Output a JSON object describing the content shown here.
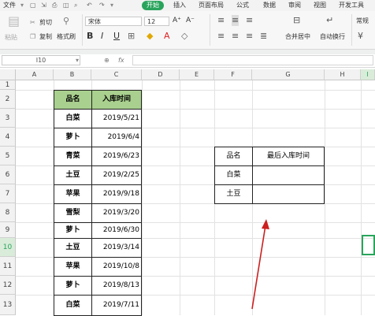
{
  "menubar": {
    "file": "文件",
    "tabs": [
      "开始",
      "插入",
      "页面布局",
      "公式",
      "数据",
      "审阅",
      "视图",
      "开发工具"
    ]
  },
  "ribbon": {
    "paste": "粘贴",
    "cut": "剪切",
    "copy": "复制",
    "format_painter": "格式刷",
    "font_name": "宋体",
    "font_size": "12",
    "grow_font": "A⁺",
    "shrink_font": "A⁻",
    "bold": "B",
    "italic": "I",
    "underline": "U",
    "merge_center": "合并居中",
    "wrap_text": "自动换行",
    "number_format": "常规"
  },
  "formula": {
    "name_box": "I10",
    "zoom_icon": "⊕",
    "fx": "fx",
    "value": ""
  },
  "columns": [
    "A",
    "B",
    "C",
    "D",
    "E",
    "F",
    "G",
    "H",
    "I"
  ],
  "rows": [
    "1",
    "2",
    "3",
    "4",
    "5",
    "6",
    "7",
    "8",
    "9",
    "10",
    "11",
    "12",
    "13"
  ],
  "table1": {
    "headers": [
      "品名",
      "入库时间"
    ],
    "rows": [
      [
        "白菜",
        "2019/5/21"
      ],
      [
        "萝卜",
        "2019/6/4"
      ],
      [
        "青菜",
        "2019/6/23"
      ],
      [
        "土豆",
        "2019/2/25"
      ],
      [
        "苹果",
        "2019/9/18"
      ],
      [
        "雪梨",
        "2019/3/20"
      ],
      [
        "萝卜",
        "2019/6/30"
      ],
      [
        "土豆",
        "2019/3/14"
      ],
      [
        "苹果",
        "2019/10/8"
      ],
      [
        "萝卜",
        "2019/8/13"
      ],
      [
        "白菜",
        "2019/7/11"
      ]
    ]
  },
  "table2": {
    "headers": [
      "品名",
      "最后入库时间"
    ],
    "rows": [
      [
        "白菜",
        ""
      ],
      [
        "土豆",
        ""
      ]
    ]
  },
  "selected_cell": "I10",
  "colors": {
    "header_fill": "#a9d08e",
    "accent": "#2aa45c",
    "arrow": "#cc1f1f"
  }
}
